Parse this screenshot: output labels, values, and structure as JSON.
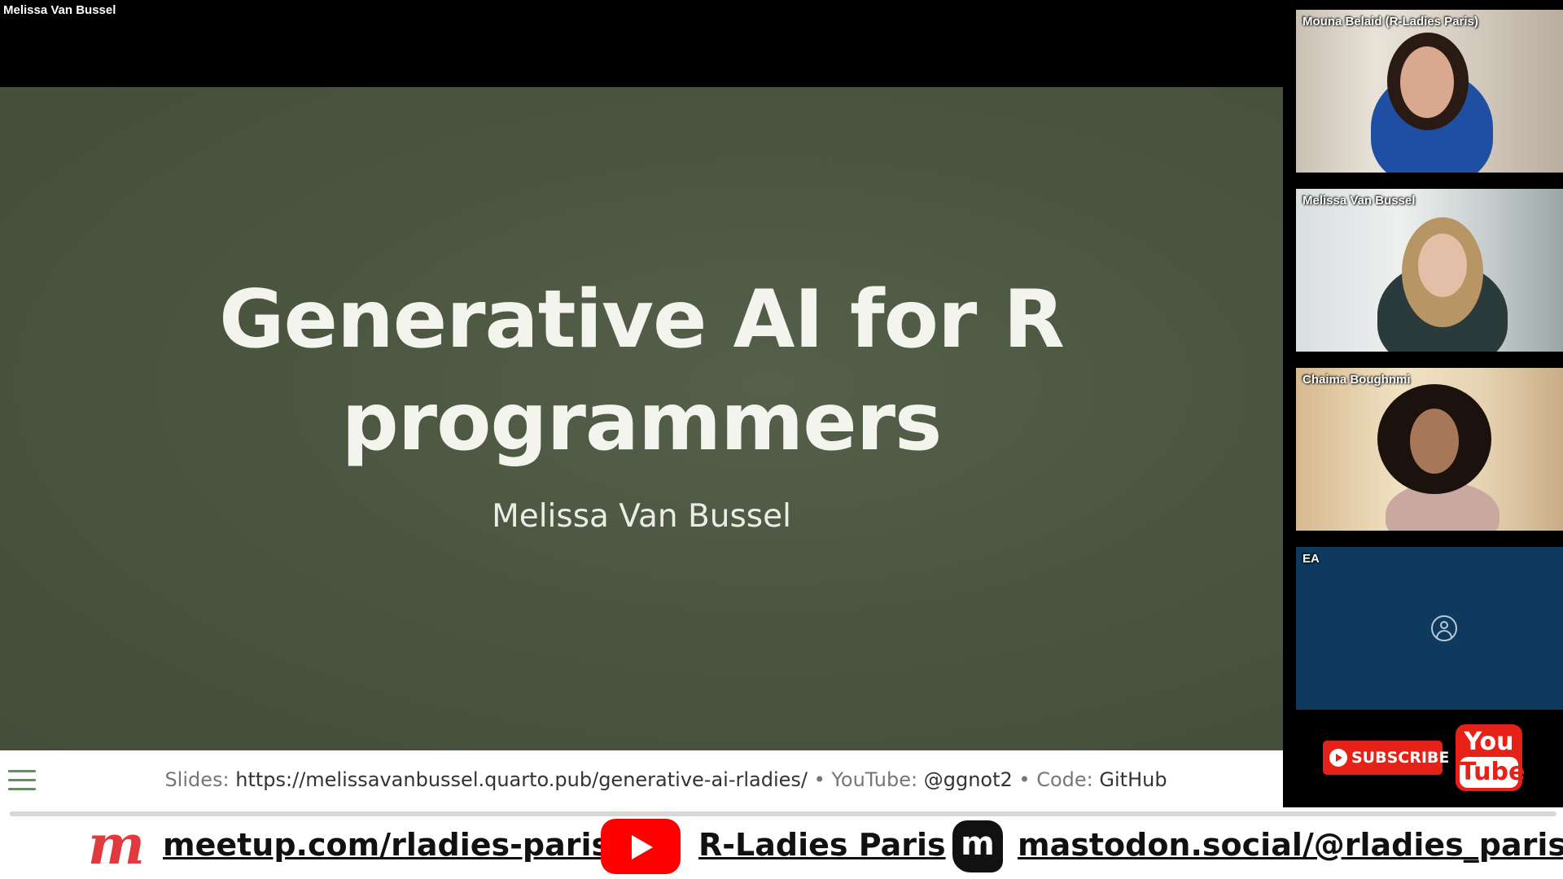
{
  "meeting": {
    "presenter_label": "Melissa Van Bussel"
  },
  "slide": {
    "title_line1": "Generative AI for R",
    "title_line2": "programmers",
    "author": "Melissa Van Bussel",
    "footer": {
      "slides_label": "Slides:",
      "slides_url": "https://melissavanbussel.quarto.pub/generative-ai-rladies/",
      "sep1": " • ",
      "youtube_label": "YouTube:",
      "youtube_handle": "@ggnot2",
      "sep2": " • ",
      "code_label": "Code:",
      "code_link": "GitHub"
    },
    "menu_icon": "hamburger-menu-icon",
    "background_color": "#4b5640"
  },
  "participants": [
    {
      "name": "Mouna Belaid (R-Ladies Paris)"
    },
    {
      "name": "Melissa Van Bussel"
    },
    {
      "name": "Chaima Boughnmi"
    },
    {
      "name": "EA",
      "avatar_icon": "person-icon"
    }
  ],
  "youtube_promo": {
    "subscribe_label": "SUBSCRIBE",
    "badge_you": "You",
    "badge_tube": "Tube",
    "accent_color": "#e62117"
  },
  "bottom_bar": {
    "meetup_icon": "meetup-logo-icon",
    "meetup_glyph": "m",
    "meetup_link": "meetup.com/rladies-paris/",
    "youtube_icon": "youtube-logo-icon",
    "youtube_channel": "R-Ladies Paris",
    "mastodon_icon": "mastodon-logo-icon",
    "mastodon_glyph": "m",
    "mastodon_link": "mastodon.social/@rladies_paris"
  }
}
